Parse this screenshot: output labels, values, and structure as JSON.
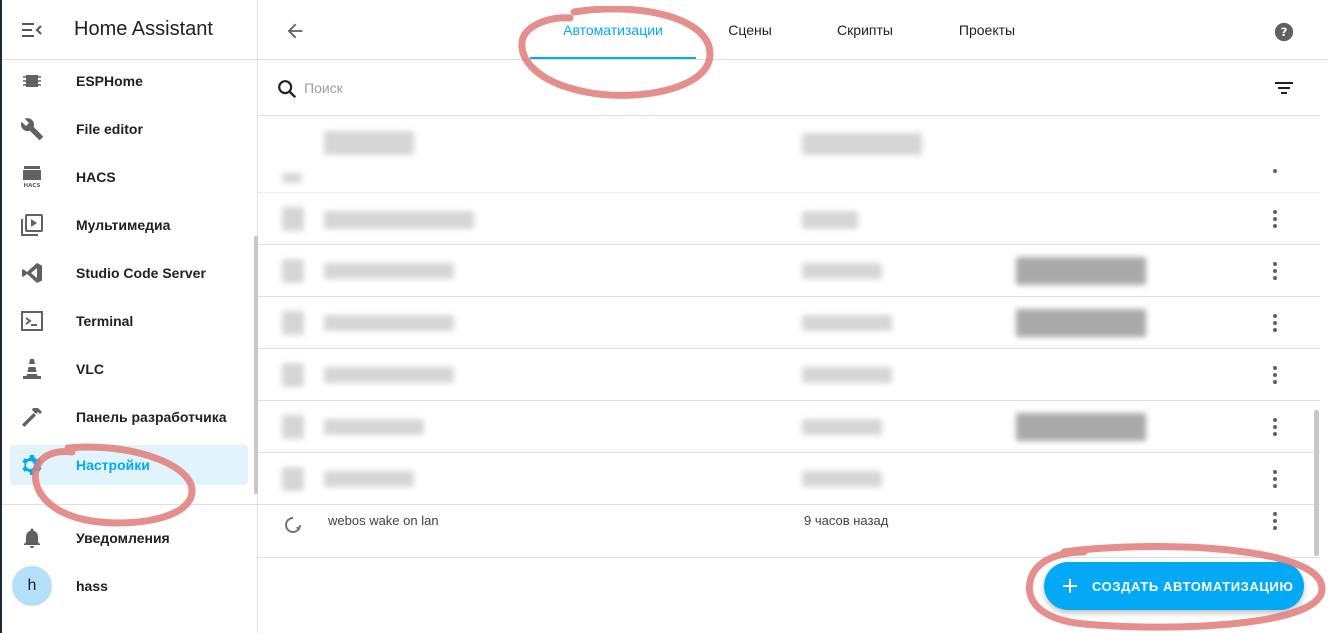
{
  "sidebar": {
    "title": "Home Assistant",
    "items": [
      {
        "label": "ESPHome",
        "icon": "chip-icon"
      },
      {
        "label": "File editor",
        "icon": "wrench-icon"
      },
      {
        "label": "HACS",
        "icon": "hacs-icon",
        "icon_text": "HACS"
      },
      {
        "label": "Мультимедиа",
        "icon": "play-box-icon"
      },
      {
        "label": "Studio Code Server",
        "icon": "vscode-icon"
      },
      {
        "label": "Terminal",
        "icon": "console-icon"
      },
      {
        "label": "VLC",
        "icon": "traffic-cone-icon"
      },
      {
        "label": "Панель разработчика",
        "icon": "hammer-icon"
      },
      {
        "label": "Настройки",
        "icon": "gear-icon",
        "active": true
      }
    ],
    "notifications_label": "Уведомления",
    "user": {
      "avatar_letter": "h",
      "name": "hass"
    }
  },
  "header": {
    "tabs": [
      {
        "label": "Автоматизации",
        "active": true
      },
      {
        "label": "Сцены"
      },
      {
        "label": "Скрипты"
      },
      {
        "label": "Проекты"
      }
    ]
  },
  "search": {
    "placeholder": "Поиск"
  },
  "list": {
    "last_row_name": "webos wake on lan",
    "last_row_time": "9 часов назад"
  },
  "fab": {
    "label": "СОЗДАТЬ АВТОМАТИЗАЦИЮ"
  },
  "colors": {
    "accent": "#03a9f4",
    "active_bg": "#e1f3fd",
    "annotation": "#e07b78"
  }
}
